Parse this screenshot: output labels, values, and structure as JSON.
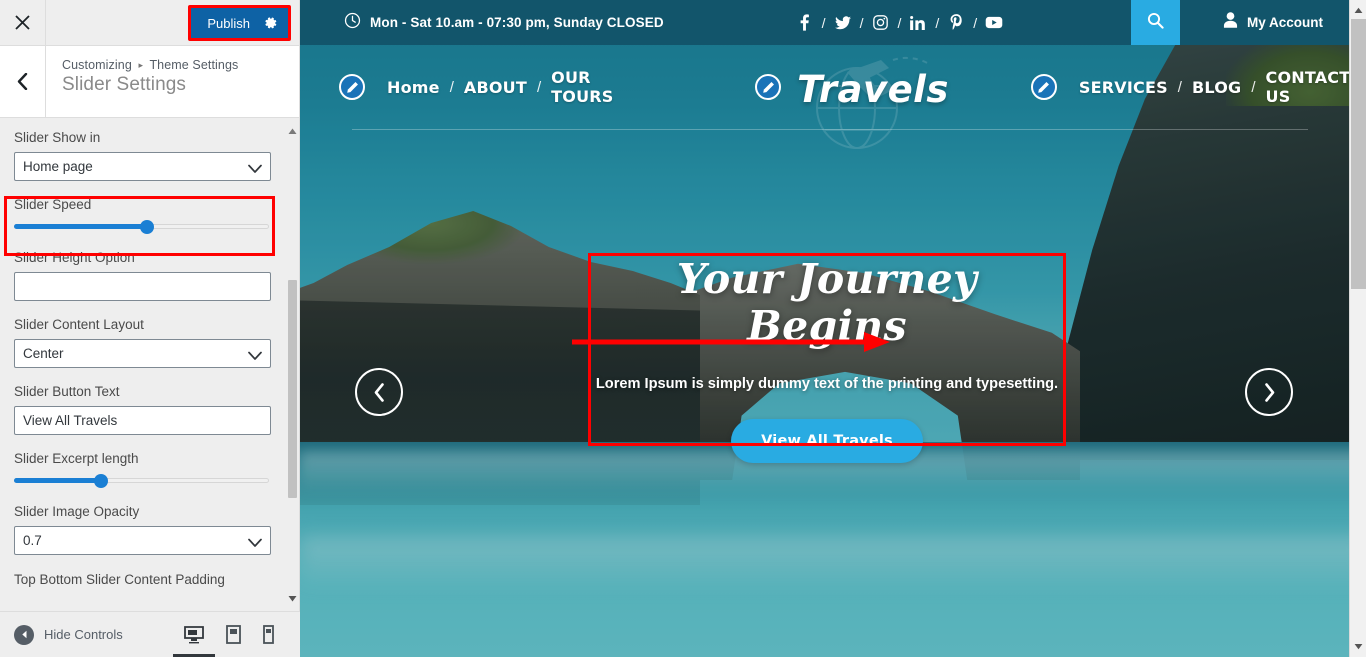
{
  "customizer": {
    "close_icon": "close-icon",
    "publish_label": "Publish",
    "gear_icon": "gear-icon",
    "back_icon": "chevron-left-icon",
    "breadcrumb_root": "Customizing",
    "breadcrumb_sep": "▸",
    "breadcrumb_parent": "Theme Settings",
    "panel_title": "Slider Settings",
    "fields": [
      {
        "label": "Slider Show in",
        "type": "select",
        "value": "Home page"
      },
      {
        "label": "Slider Speed",
        "type": "range",
        "value": 52
      },
      {
        "label": "Slider Height Option",
        "type": "text",
        "value": ""
      },
      {
        "label": "Slider Content Layout",
        "type": "select",
        "value": "Center",
        "highlighted": true
      },
      {
        "label": "Slider Button Text",
        "type": "text",
        "value": "View All Travels"
      },
      {
        "label": "Slider Excerpt length",
        "type": "range",
        "value": 34
      },
      {
        "label": "Slider Image Opacity",
        "type": "select",
        "value": "0.7"
      },
      {
        "label": "Top Bottom Slider Content Padding",
        "type": "partial",
        "value": ""
      }
    ],
    "footer": {
      "hide_controls_label": "Hide Controls",
      "devices": [
        {
          "name": "desktop",
          "active": true
        },
        {
          "name": "tablet",
          "active": false
        },
        {
          "name": "mobile",
          "active": false
        }
      ]
    }
  },
  "preview": {
    "topbar": {
      "clock_icon": "clock-icon",
      "hours": "Mon - Sat 10.am - 07:30 pm, Sunday CLOSED",
      "socials": [
        {
          "name": "facebook"
        },
        {
          "name": "twitter"
        },
        {
          "name": "instagram"
        },
        {
          "name": "linkedin"
        },
        {
          "name": "pinterest"
        },
        {
          "name": "youtube"
        }
      ],
      "social_separator": "/",
      "search_icon": "search-icon",
      "account_icon": "user-icon",
      "account_label": "My Account"
    },
    "nav": {
      "left_links": [
        "Home",
        "ABOUT",
        "OUR TOURS"
      ],
      "right_links": [
        "SERVICES",
        "BLOG",
        "CONTACT US"
      ],
      "separator": "/",
      "brand": "Travels",
      "edit_icon": "pencil-edit-icon"
    },
    "slider": {
      "prev_icon": "chevron-left-icon",
      "next_icon": "chevron-right-icon",
      "title": "Your Journey Begins",
      "subtitle": "Lorem Ipsum is simply dummy text of the printing and typesetting.",
      "button_label": "View All Travels"
    }
  },
  "colors": {
    "publish_blue": "#0e62a5",
    "highlight_red": "#ff0000",
    "topbar_teal": "#12556b",
    "accent_cyan": "#29abe2",
    "slider_blue": "#1a7fd4"
  }
}
